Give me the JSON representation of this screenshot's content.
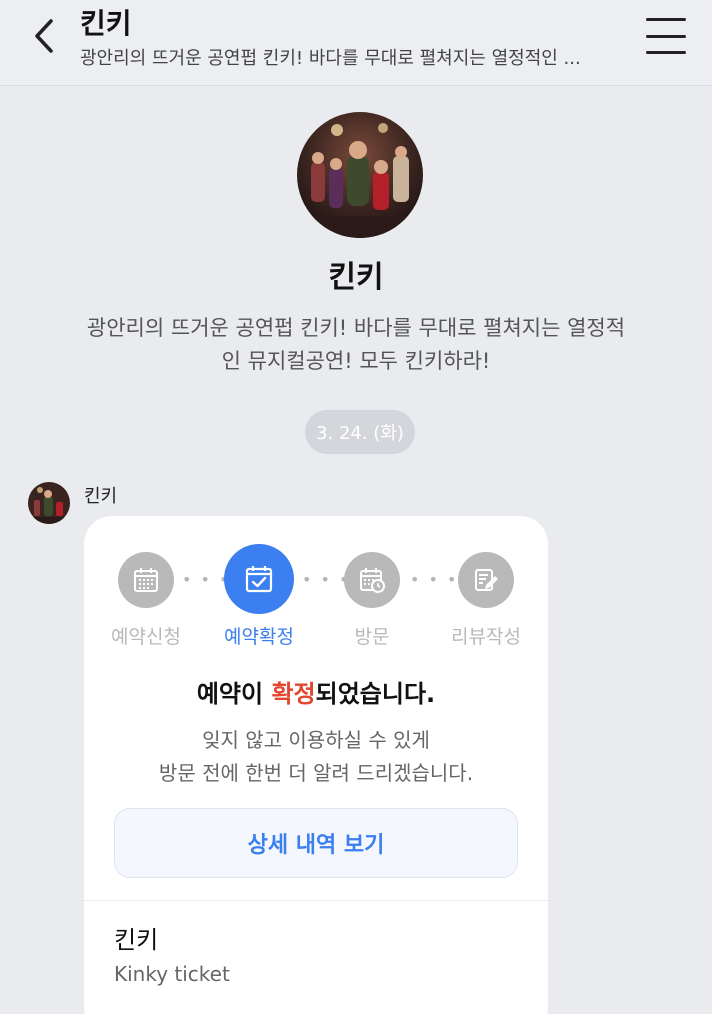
{
  "header": {
    "title": "킨키",
    "subtitle": "광안리의 뜨거운 공연펍 킨키! 바다를 무대로 펼쳐지는 열정적인 ..."
  },
  "profile": {
    "name": "킨키",
    "desc_line1": "광안리의 뜨거운 공연펍 킨키! 바다를 무대로 펼쳐지는 열정적",
    "desc_line2": "인 뮤지컬공연! 모두 킨키하라!"
  },
  "date_pill": "3. 24. (화)",
  "sender": {
    "name": "킨키"
  },
  "card": {
    "steps": [
      {
        "label": "예약신청",
        "icon": "calendar-grid-icon",
        "active": false
      },
      {
        "label": "예약확정",
        "icon": "calendar-check-icon",
        "active": true
      },
      {
        "label": "방문",
        "icon": "calendar-clock-icon",
        "active": false
      },
      {
        "label": "리뷰작성",
        "icon": "edit-note-icon",
        "active": false
      }
    ],
    "title_prefix": "예약이 ",
    "title_highlight": "확정",
    "title_suffix": "되었습니다.",
    "desc_line1": "잊지 않고 이용하실 수 있게",
    "desc_line2": "방문 전에 한번 더 알려 드리겠습니다.",
    "detail_button": "상세 내역 보기",
    "product_name": "킨키",
    "product_sub": "Kinky ticket"
  },
  "colors": {
    "accent": "#3c7ff0",
    "highlight": "#e2462e",
    "background": "#e9ebef"
  }
}
